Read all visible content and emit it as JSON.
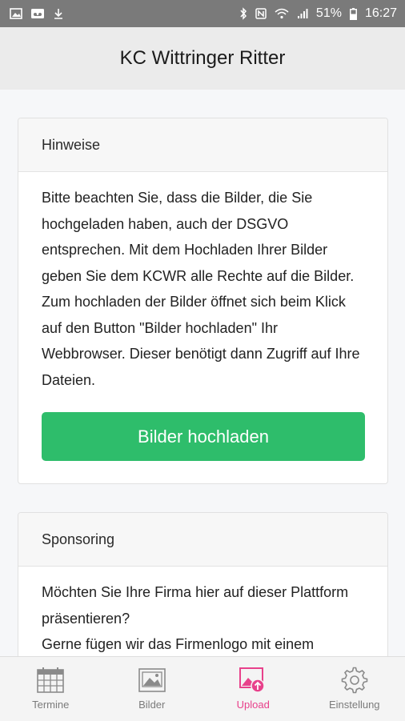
{
  "status_bar": {
    "battery_percent": "51%",
    "time": "16:27",
    "left_icons": [
      "image-icon",
      "voicemail-icon",
      "download-icon"
    ],
    "right_icons": [
      "bluetooth-icon",
      "nfc-icon",
      "wifi-icon",
      "signal-icon",
      "battery-icon"
    ]
  },
  "header": {
    "title": "KC Wittringer Ritter"
  },
  "cards": {
    "hinweise": {
      "title": "Hinweise",
      "body": "Bitte beachten Sie, dass die Bilder, die Sie hochgeladen haben, auch der DSGVO entsprechen. Mit dem Hochladen Ihrer Bilder geben Sie dem KCWR alle Rechte auf die Bilder. Zum hochladen der Bilder öffnet sich beim Klick auf den Button \"Bilder hochladen\" Ihr Webbrowser. Dieser benötigt dann Zugriff auf Ihre Dateien.",
      "button_label": "Bilder hochladen"
    },
    "sponsoring": {
      "title": "Sponsoring",
      "body_line1": "Möchten Sie Ihre Firma hier auf dieser Plattform präsentieren?",
      "body_line2": "Gerne fügen wir das Firmenlogo mit einem"
    }
  },
  "tabs": {
    "termine": {
      "label": "Termine",
      "icon": "calendar-icon"
    },
    "bilder": {
      "label": "Bilder",
      "icon": "picture-icon"
    },
    "upload": {
      "label": "Upload",
      "icon": "upload-image-icon",
      "active": true
    },
    "einstellung": {
      "label": "Einstellung",
      "icon": "gear-icon"
    }
  },
  "colors": {
    "status_bar": "#7a7a7a",
    "header_bg": "#ebebeb",
    "button_green": "#2ebd6b",
    "active_tab": "#e8418b",
    "inactive_tab": "#7b7b7b"
  }
}
